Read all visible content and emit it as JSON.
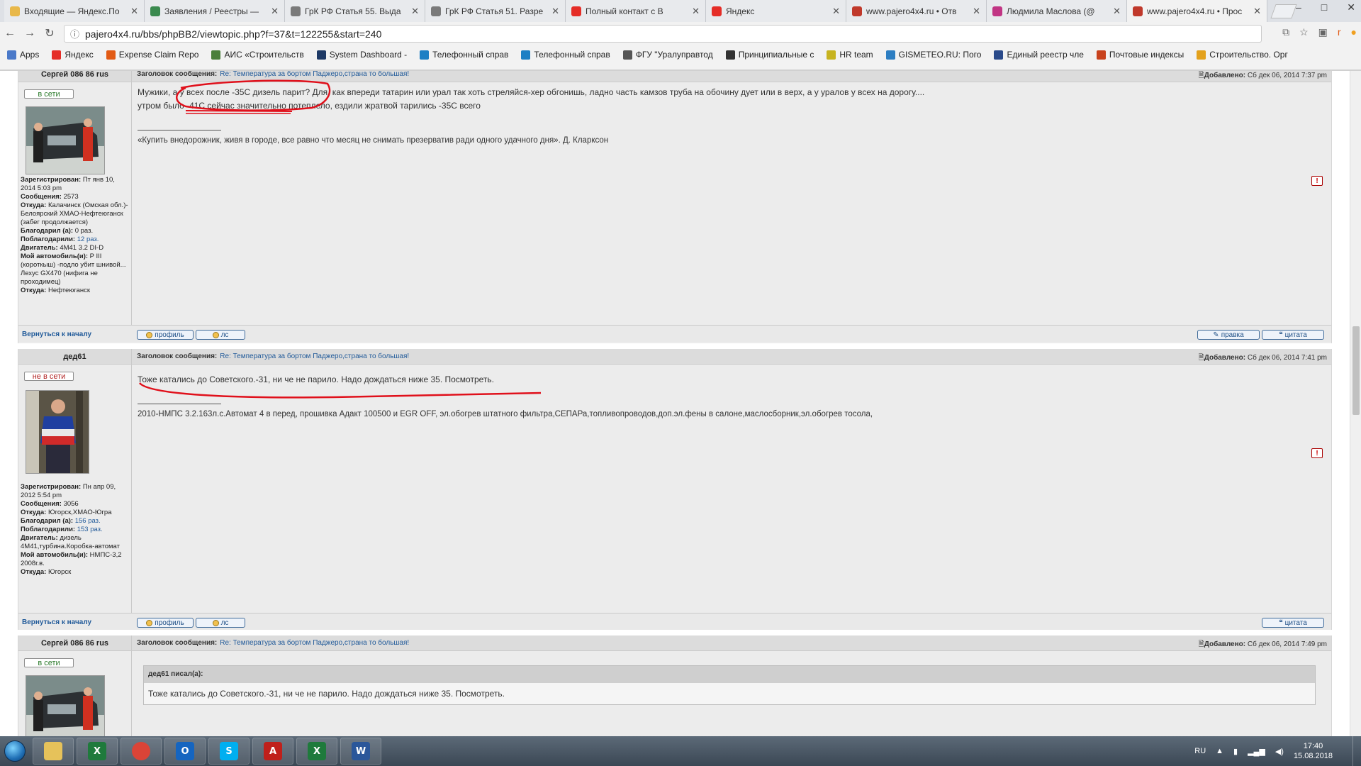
{
  "browser": {
    "tabs": [
      {
        "label": "Входящие — Яндекс.По",
        "color": "#e8b84a"
      },
      {
        "label": "Заявления / Реестры —",
        "color": "#3b8a4f"
      },
      {
        "label": "ГрК РФ Статья 55. Выда",
        "color": "#7a7a7a"
      },
      {
        "label": "ГрК РФ Статья 51. Разре",
        "color": "#7a7a7a"
      },
      {
        "label": "Полный контакт с В",
        "color": "#e52d27"
      },
      {
        "label": "Яндекс",
        "color": "#e52d27"
      },
      {
        "label": "www.pajero4x4.ru • Отв",
        "color": "#c0392b"
      },
      {
        "label": "Людмила Маслова (@",
        "color": "#c13584"
      },
      {
        "label": "www.pajero4x4.ru • Прос",
        "color": "#c0392b"
      }
    ],
    "url": "pajero4x4.ru/bbs/phpBB2/viewtopic.php?f=37&t=122255&start=240",
    "bookmarks": [
      {
        "label": "Apps",
        "color": "#4a79c9"
      },
      {
        "label": "Яндекс",
        "color": "#e52d27"
      },
      {
        "label": "Expense Claim Repo",
        "color": "#e25a14"
      },
      {
        "label": "АИС «Строительств",
        "color": "#4a7f3b"
      },
      {
        "label": "System Dashboard -",
        "color": "#1e3a66"
      },
      {
        "label": "Телефонный справ",
        "color": "#1c7fc4"
      },
      {
        "label": "Телефонный справ",
        "color": "#1c7fc4"
      },
      {
        "label": "ФГУ \"Уралуправтод",
        "color": "#555555"
      },
      {
        "label": "Принципиальные с",
        "color": "#333333"
      },
      {
        "label": "HR team",
        "color": "#c7b31f"
      },
      {
        "label": "GISMETEO.RU: Пого",
        "color": "#2d7ec2"
      },
      {
        "label": "Единый реестр чле",
        "color": "#2a4a8a"
      },
      {
        "label": "Почтовые индексы",
        "color": "#c8421d"
      },
      {
        "label": "Строительство. Орг",
        "color": "#e3a11c"
      }
    ]
  },
  "forum": {
    "subject_label": "Заголовок сообщения:",
    "subject": "Re: Температура за бортом Паджеро,страна то большая!",
    "added_label": "Добавлено:",
    "back_to_top": "Вернуться к началу",
    "btn_profile": "профиль",
    "btn_pm": "лс",
    "btn_edit": "правка",
    "btn_quote": "цитата",
    "report_symbol": "!",
    "posts": [
      {
        "author": "Сергей 086 86 rus",
        "status": "в сети",
        "date": "Сб дек 06, 2014 7:37 pm",
        "message_lines": [
          "Мужики, а у всех после -35С дизель парит? Для, как впереди татарин или урал так хоть стреляйся-хер обгонишь, ладно часть камзов труба на обочину дует или в верх, а у уралов у всех на дорогу....",
          "утром было -41С сейчас значительно потеплело, ездили жратвой тарились -35С всего"
        ],
        "signature": "«Купить внедорожник, живя в городе, все равно что месяц не снимать презерватив ради одного удачного дня». Д. Кларксон",
        "profile": [
          {
            "k": "Зарегистрирован:",
            "v": "Пт янв 10, 2014 5:03 pm"
          },
          {
            "k": "Сообщения:",
            "v": "2573"
          },
          {
            "k": "Откуда:",
            "v": "Калачинск (Омская обл.)-Белоярский ХМАО-Нефтеюганск (забег продолжается)"
          },
          {
            "k": "Благодарил (а):",
            "v": "0 раз."
          },
          {
            "k": "Поблагодарили:",
            "v": "12 раз."
          },
          {
            "k": "Двигатель:",
            "v": "4M41 3.2 DI-D"
          },
          {
            "k": "Мой автомобиль(и):",
            "v": "P III (короткыш) -подло убит шнивой... Лехус GX470 (нифига не проходимец)"
          },
          {
            "k": "Откуда:",
            "v": "Нефтеюганск"
          }
        ]
      },
      {
        "author": "дед61",
        "status": "не в сети",
        "date": "Сб дек 06, 2014 7:41 pm",
        "message_lines": [
          "Тоже катались до Советского.-31, ни че не парило. Надо дождаться ниже 35. Посмотреть."
        ],
        "signature": "2010-НМПС 3.2.163л.с.Автомат 4 в перед, прошивка Адакт 100500 и EGR OFF, эл.обогрев штатного фильтра,СЕПАРа,топливопроводов,доп.эл.фены в салоне,маслосборник,эл.обогрев тосола,",
        "profile": [
          {
            "k": "Зарегистрирован:",
            "v": "Пн апр 09, 2012 5:54 pm"
          },
          {
            "k": "Сообщения:",
            "v": "3056"
          },
          {
            "k": "Откуда:",
            "v": "Югорск,ХМАО-Югра"
          },
          {
            "k": "Благодарил (а):",
            "v": "156 раз."
          },
          {
            "k": "Поблагодарили:",
            "v": "153 раз."
          },
          {
            "k": "Двигатель:",
            "v": "дизель 4М41,турбина.Коробка-автомат"
          },
          {
            "k": "Мой автомобиль(и):",
            "v": "НМПС-3,2 2008г.в."
          },
          {
            "k": "Откуда:",
            "v": "Югорск"
          }
        ]
      },
      {
        "author": "Сергей 086 86 rus",
        "status": "в сети",
        "date": "Сб дек 06, 2014 7:49 pm",
        "quote_author": "дед61 писал(а):",
        "quote_text": "Тоже катались до Советского.-31, ни че не парило. Надо дождаться ниже 35. Посмотреть."
      }
    ]
  },
  "taskbar": {
    "apps": [
      {
        "name": "explorer",
        "label": "",
        "color": "#e6c25a"
      },
      {
        "name": "excel-green",
        "label": "X",
        "color": "#1f7a3c"
      },
      {
        "name": "chrome",
        "label": "",
        "color": "#db4437"
      },
      {
        "name": "outlook",
        "label": "O",
        "color": "#1565c0"
      },
      {
        "name": "skype",
        "label": "S",
        "color": "#00aff0"
      },
      {
        "name": "acrobat",
        "label": "A",
        "color": "#c0201b"
      },
      {
        "name": "excel",
        "label": "X",
        "color": "#1f7a3c"
      },
      {
        "name": "word",
        "label": "W",
        "color": "#2b579a"
      }
    ],
    "lang": "RU",
    "time": "17:40",
    "date": "15.08.2018"
  },
  "colors": {
    "annotation_red": "#e0101b",
    "link_blue": "#225b9a"
  }
}
